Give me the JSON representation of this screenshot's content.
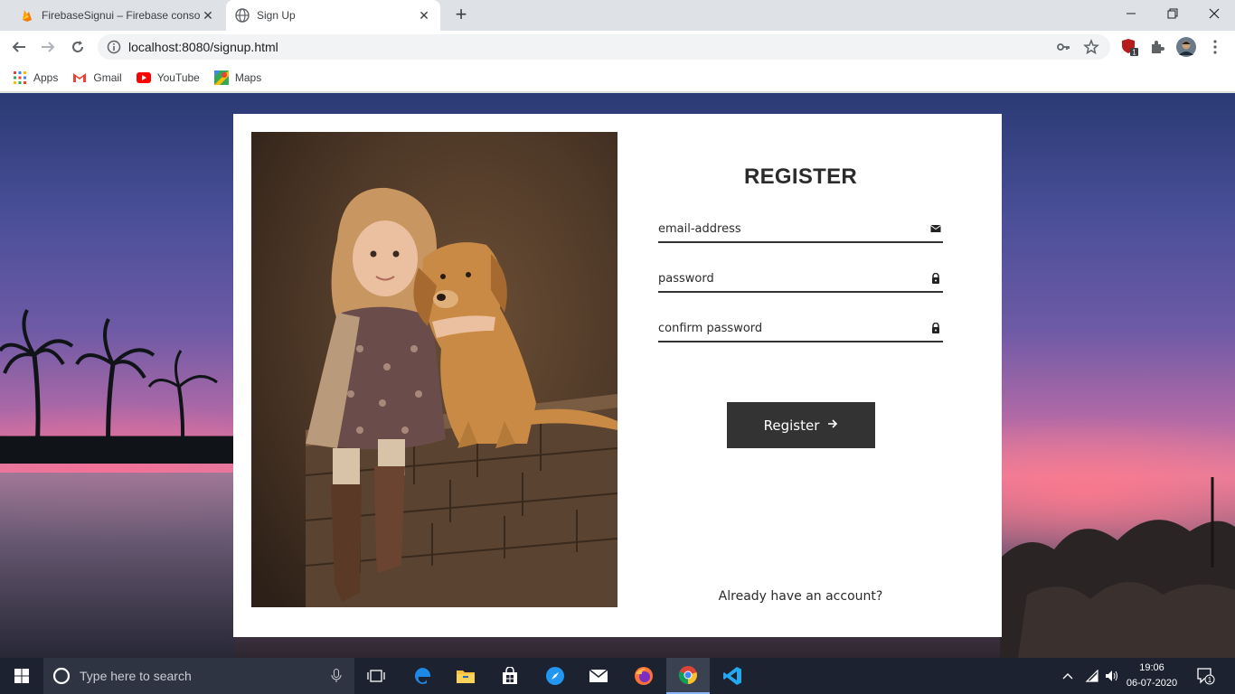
{
  "browser": {
    "tabs": [
      {
        "title": "FirebaseSignui – Firebase console",
        "active": false
      },
      {
        "title": "Sign Up",
        "active": true
      }
    ],
    "new_tab_label": "+",
    "address": "localhost:8080/signup.html",
    "bookmarks": [
      {
        "label": "Apps",
        "icon": "apps-grid-icon"
      },
      {
        "label": "Gmail",
        "icon": "gmail-icon"
      },
      {
        "label": "YouTube",
        "icon": "youtube-icon"
      },
      {
        "label": "Maps",
        "icon": "maps-icon"
      }
    ],
    "extension_badge": "1"
  },
  "register": {
    "title": "REGISTER",
    "email_placeholder": "email-address",
    "password_placeholder": "password",
    "confirm_placeholder": "confirm password",
    "button_label": "Register",
    "login_prompt": "Already have an account?"
  },
  "taskbar": {
    "search_placeholder": "Type here to search",
    "time": "19:06",
    "date": "06-07-2020",
    "notification_count": "1"
  },
  "colors": {
    "accent_dark": "#333333",
    "taskbar": "#1c2230",
    "chrome_frame": "#dee1e6"
  }
}
